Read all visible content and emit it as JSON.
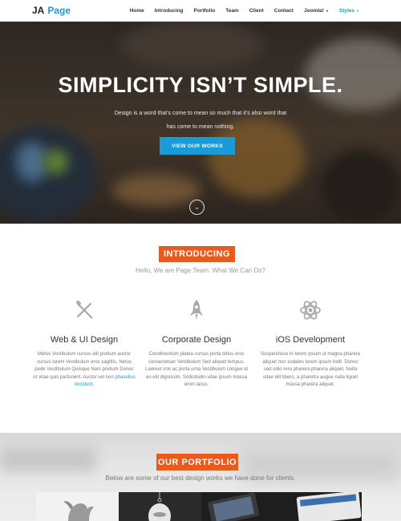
{
  "brand": {
    "name_a": "JA",
    "name_b": "Page",
    "accent": "#1a9ad6"
  },
  "nav": {
    "items": [
      "Home",
      "Introducing",
      "Portfolio",
      "Team",
      "Client",
      "Contact",
      "Joomla!",
      "Styles"
    ]
  },
  "hero": {
    "title": "SIMPLICITY ISN’T SIMPLE.",
    "description": "Design is a word that’s come to mean so much that it’s also word that has come to mean nothing.",
    "button": "VIEW OUR WORKS"
  },
  "intro": {
    "label": "INTRODUCING",
    "subtitle": "Hello, We are Page.Team. What We Can Do?",
    "services": [
      {
        "icon": "tools-icon",
        "title": "Web & UI Design",
        "text": "Metus Vestibulum cursus elit pretium auctor cursus lorem Vestibulum eros sagittis. Netus pede Vestibulum Quisque Nam pretium Donec ut vitae quis parturient. Auctor vel non",
        "link": "phasellus tincidunt."
      },
      {
        "icon": "rocket-icon",
        "title": "Corporate Design",
        "text": "Condimentum platea cursus porta tellus eros consectetuer Vestibulum Sed aliquet tempus. Laoreet non ac porta urna Vestibulum congue id eu elit dignissim. Sollicitudin vitae ipsum massa enim lacus."
      },
      {
        "icon": "atom-icon",
        "title": "iOS Development",
        "text": "Suspendisse in lorem ipsum ut magna pharera aliquet non sodales lorem ipsum belit. Donec sed odio rera pharera pharera aliquet. Nulla uitae elit libero, a pharetra augue nulla liquet massa pharera aliquet."
      }
    ]
  },
  "portfolio": {
    "label": "OUR PORTFOLIO",
    "subtitle": "Below are some of our best design works we have done for clients."
  },
  "colors": {
    "orange": "#ea5a1c",
    "blue": "#1a9ad6"
  }
}
